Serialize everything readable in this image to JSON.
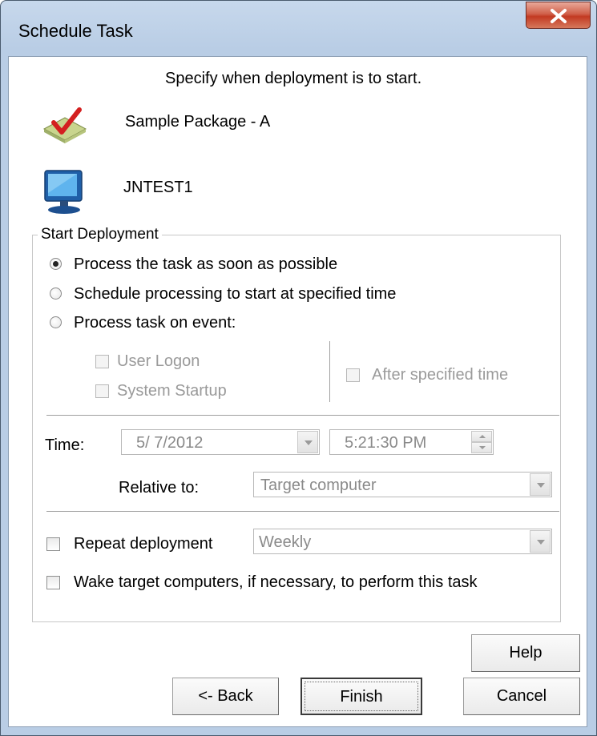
{
  "window": {
    "title": "Schedule Task",
    "close_icon": "close-icon"
  },
  "header": {
    "instruction": "Specify when deployment is to start.",
    "package_name": "Sample Package - A",
    "package_icon": "package-check-icon",
    "computer_name": "JNTEST1",
    "computer_icon": "computer-monitor-icon"
  },
  "start_deployment": {
    "legend": "Start Deployment",
    "options": [
      {
        "label": "Process the task as soon as possible",
        "selected": true
      },
      {
        "label": "Schedule processing to start at specified time",
        "selected": false
      },
      {
        "label": "Process task on event:",
        "selected": false
      }
    ],
    "events": {
      "user_logon": "User Logon",
      "system_startup": "System Startup",
      "after_specified_time": "After specified time"
    },
    "time_label": "Time:",
    "date_value": "5/  7/2012",
    "time_value": "5:21:30 PM",
    "relative_label": "Relative to:",
    "relative_value": "Target computer",
    "repeat_label": "Repeat deployment",
    "repeat_value": "Weekly",
    "wake_label": "Wake target computers, if necessary, to perform this task"
  },
  "buttons": {
    "help": "Help",
    "back": "<- Back",
    "finish": "Finish",
    "cancel": "Cancel"
  },
  "colors": {
    "title_bar": "#b9cde5",
    "close_button": "#c23a22",
    "disabled_text": "#9a9a9a"
  }
}
